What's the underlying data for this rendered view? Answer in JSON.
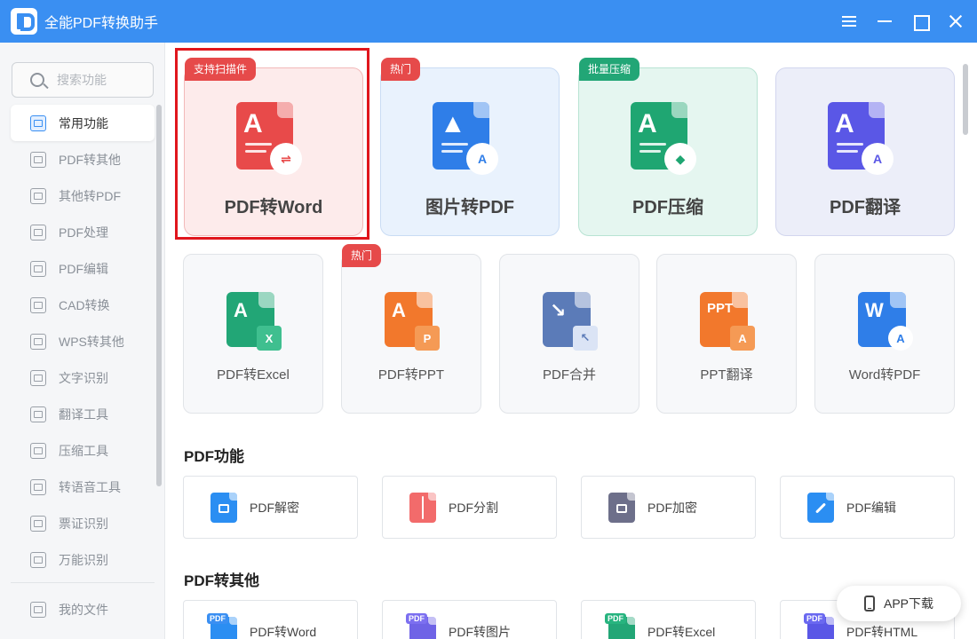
{
  "app": {
    "title": "全能PDF转换助手"
  },
  "search": {
    "placeholder": "搜索功能"
  },
  "sidebar": {
    "items": [
      {
        "label": "常用功能",
        "active": true
      },
      {
        "label": "PDF转其他"
      },
      {
        "label": "其他转PDF"
      },
      {
        "label": "PDF处理"
      },
      {
        "label": "PDF编辑"
      },
      {
        "label": "CAD转换"
      },
      {
        "label": "WPS转其他"
      },
      {
        "label": "文字识别"
      },
      {
        "label": "翻译工具"
      },
      {
        "label": "压缩工具"
      },
      {
        "label": "转语音工具"
      },
      {
        "label": "票证识别"
      },
      {
        "label": "万能识别"
      }
    ],
    "my_files": "我的文件"
  },
  "featured": [
    {
      "label": "PDF转Word",
      "badge": "支持扫描件",
      "color": "#e84a4a"
    },
    {
      "label": "图片转PDF",
      "badge": "热门",
      "color": "#2f7ee8"
    },
    {
      "label": "PDF压缩",
      "badge": "批量压缩",
      "color": "#1fa672"
    },
    {
      "label": "PDF翻译",
      "color": "#5a57e6"
    }
  ],
  "tools": [
    {
      "label": "PDF转Excel",
      "color": "#22a676"
    },
    {
      "label": "PDF转PPT",
      "badge": "热门",
      "color": "#f2782c"
    },
    {
      "label": "PDF合并",
      "color": "#5b7bb8"
    },
    {
      "label": "PPT翻译",
      "color": "#f2782c"
    },
    {
      "label": "Word转PDF",
      "color": "#2f7ee8"
    }
  ],
  "icons": {
    "featured_glyphs": [
      "A",
      "▲",
      "A",
      "A"
    ],
    "featured_subs": [
      "⇌",
      "A",
      "◆",
      "A"
    ],
    "tool_glyphs": [
      "A",
      "A",
      "↘",
      "PPT",
      "W"
    ],
    "tool_subs": [
      "X",
      "P",
      "↖",
      "A",
      "A"
    ]
  },
  "pdf_functions": {
    "title": "PDF功能",
    "items": [
      {
        "label": "PDF解密",
        "color": "#2b8ef2"
      },
      {
        "label": "PDF分割",
        "color": "#f26b6b"
      },
      {
        "label": "PDF加密",
        "color": "#6d6f8a"
      },
      {
        "label": "PDF编辑",
        "color": "#2b8ef2"
      }
    ]
  },
  "pdf_to_other": {
    "title": "PDF转其他",
    "badge": "PDF",
    "items": [
      {
        "label": "PDF转Word",
        "color": "#2b8ef2"
      },
      {
        "label": "PDF转图片",
        "color": "#6f63e6"
      },
      {
        "label": "PDF转Excel",
        "color": "#22a676"
      },
      {
        "label": "PDF转HTML",
        "color": "#5a57e6"
      }
    ]
  },
  "app_download": {
    "label": "APP下载"
  }
}
